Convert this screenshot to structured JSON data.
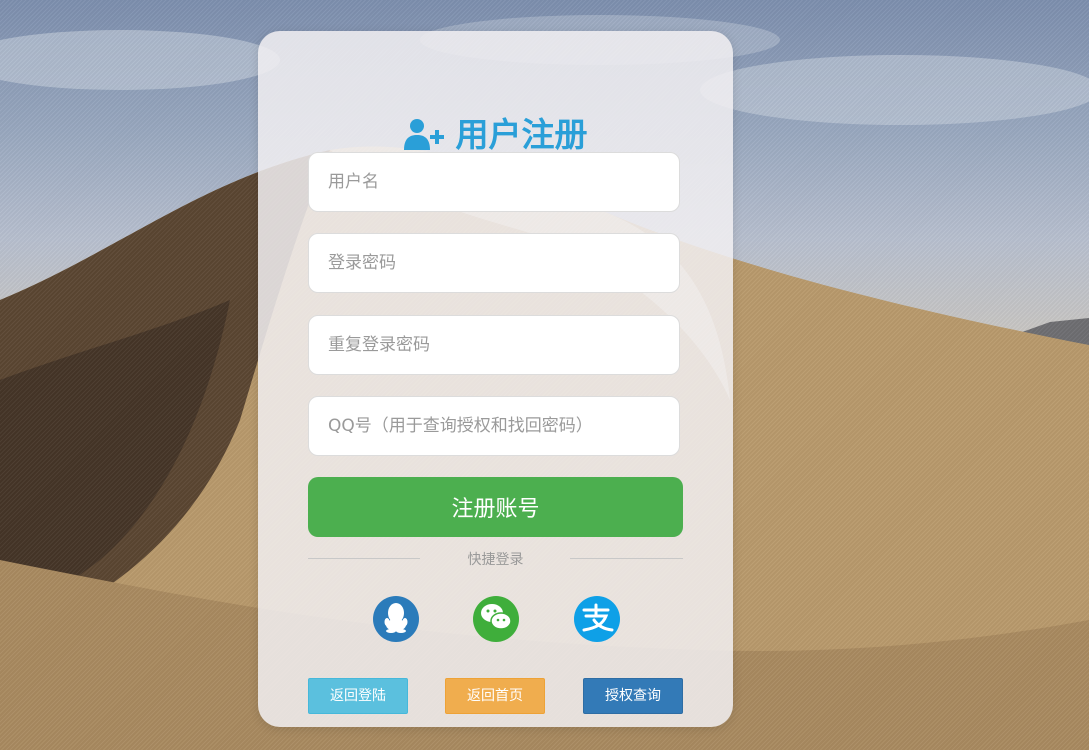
{
  "title": "用户注册",
  "form": {
    "username_placeholder": "用户名",
    "password_placeholder": "登录密码",
    "repeat_password_placeholder": "重复登录密码",
    "qq_placeholder": "QQ号（用于查询授权和找回密码）",
    "submit_label": "注册账号"
  },
  "quick_login": {
    "label": "快捷登录",
    "providers": [
      {
        "name": "qq",
        "icon": "qq-icon",
        "color": "#2b7bba"
      },
      {
        "name": "wechat",
        "icon": "wechat-icon",
        "color": "#3fae3b"
      },
      {
        "name": "alipay",
        "icon": "alipay-icon",
        "color": "#0ea0e7"
      }
    ]
  },
  "actions": {
    "back_login": "返回登陆",
    "back_home": "返回首页",
    "auth_query": "授权查询"
  },
  "colors": {
    "accent": "#2a9fd8",
    "submit": "#4caf4f",
    "back_login": "#5bc0de",
    "back_home": "#f0ad4e",
    "auth_query": "#337ab7"
  }
}
